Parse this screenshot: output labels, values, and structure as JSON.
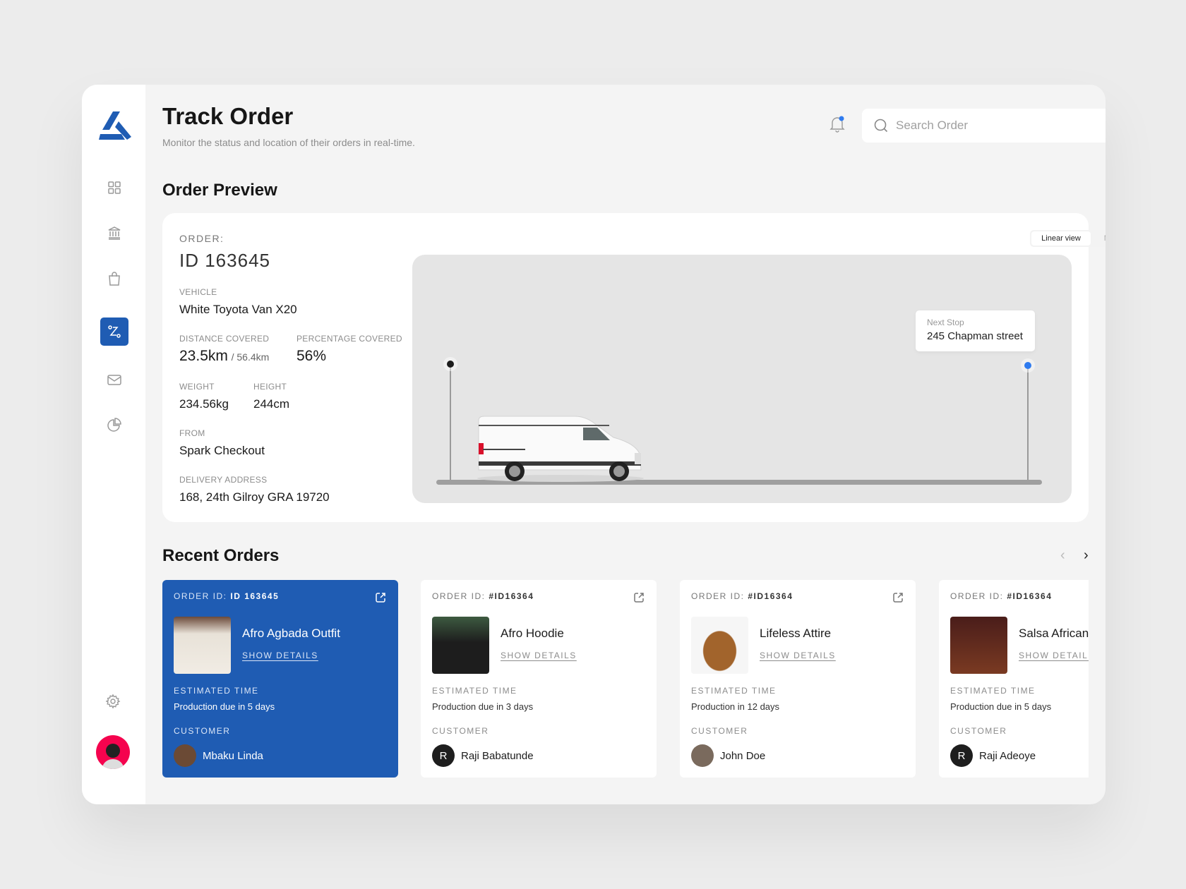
{
  "sidebar": {
    "items": [
      {
        "name": "dashboard",
        "icon": "grid-icon",
        "active": false
      },
      {
        "name": "bank",
        "icon": "bank-icon",
        "active": false
      },
      {
        "name": "orders",
        "icon": "shopping-bag-icon",
        "active": false
      },
      {
        "name": "track-order",
        "icon": "route-icon",
        "active": true
      },
      {
        "name": "messages",
        "icon": "mail-icon",
        "active": false
      },
      {
        "name": "analytics",
        "icon": "pie-chart-icon",
        "active": false
      }
    ],
    "settings_icon": "gear-icon",
    "brand_color": "#1f5cb3",
    "avatar_bg": "#f5034e"
  },
  "header": {
    "title": "Track Order",
    "subtitle": "Monitor the status and location of their orders in real-time.",
    "search_placeholder": "Search Order",
    "notification_dot_color": "#2f7bef"
  },
  "preview": {
    "section_title": "Order Preview",
    "order_label": "ORDER:",
    "order_id": "ID 163645",
    "vehicle_label": "VEHICLE",
    "vehicle": "White Toyota Van X20",
    "distance_label": "DISTANCE COVERED",
    "distance": "23.5km",
    "distance_total": "/ 56.4km",
    "percentage_label": "PERCENTAGE COVERED",
    "percentage": "56%",
    "weight_label": "WEIGHT",
    "weight": "234.56kg",
    "height_label": "HEIGHT",
    "height": "244cm",
    "from_label": "FROM",
    "from": "Spark Checkout",
    "address_label": "DELIVERY ADDRESS",
    "address": "168, 24th Gilroy GRA 19720",
    "views": {
      "linear": "Linear view",
      "map": "Map view",
      "selected": "Linear view"
    },
    "next_stop_label": "Next Stop",
    "next_stop": "245 Chapman street",
    "progress_fraction": 0.56
  },
  "recent": {
    "section_title": "Recent Orders",
    "order_id_label": "ORDER ID:",
    "est_label": "ESTIMATED TIME",
    "customer_label": "CUSTOMER",
    "details_label": "SHOW DETAILS",
    "orders": [
      {
        "id": "ID 163645",
        "product": "Afro Agbada Outfit",
        "estimate": "Production due in 5 days",
        "customer": "Mbaku Linda",
        "initial": "",
        "active": true
      },
      {
        "id": "#ID16364",
        "product": "Afro Hoodie",
        "estimate": "Production due in 3 days",
        "customer": "Raji Babatunde",
        "initial": "R",
        "active": false
      },
      {
        "id": "#ID16364",
        "product": "Lifeless Attire",
        "estimate": "Production in 12 days",
        "customer": "John Doe",
        "initial": "",
        "active": false
      },
      {
        "id": "#ID16364",
        "product": "Salsa African",
        "estimate": "Production due in 5 days",
        "customer": "Raji Adeoye",
        "initial": "R",
        "active": false
      }
    ]
  }
}
